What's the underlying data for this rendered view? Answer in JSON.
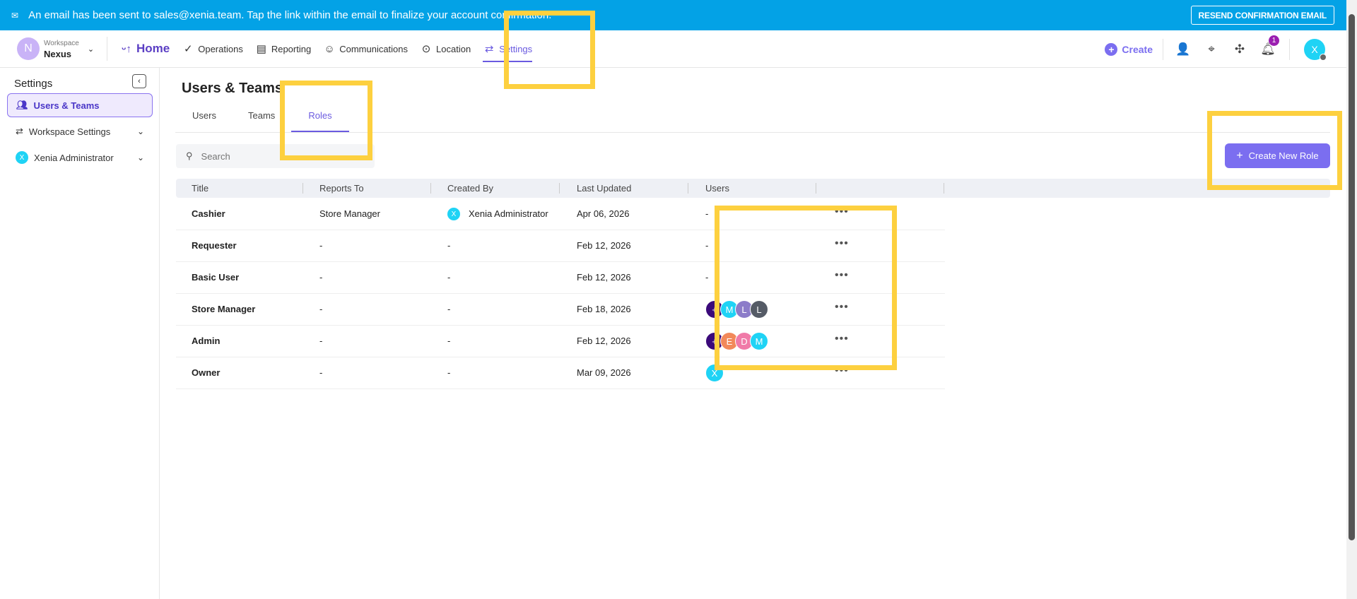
{
  "banner": {
    "message": "An email has been sent to sales@xenia.team. Tap the link within the email to finalize your account confirmation.",
    "resend": "RESEND CONFIRMATION EMAIL"
  },
  "nav": {
    "workspace_label": "Workspace",
    "workspace_name": "Nexus",
    "workspace_initial": "N",
    "home": "Home",
    "items": [
      "Operations",
      "Reporting",
      "Communications",
      "Location",
      "Settings"
    ],
    "create": "Create",
    "notification_count": "1",
    "user_initial": "X"
  },
  "sidebar": {
    "header": "Settings",
    "items": [
      {
        "label": "Users & Teams"
      },
      {
        "label": "Workspace Settings"
      },
      {
        "label": "Xenia Administrator",
        "initial": "X"
      }
    ]
  },
  "page": {
    "title": "Users & Teams",
    "tabs": [
      "Users",
      "Teams",
      "Roles"
    ],
    "search_placeholder": "Search",
    "create_role": "Create New Role"
  },
  "table": {
    "headers": [
      "Title",
      "Reports To",
      "Created By",
      "Last Updated",
      "Users"
    ],
    "rows": [
      {
        "title": "Cashier",
        "reports_to": "Store Manager",
        "created_by": "Xenia Administrator",
        "created_initial": "X",
        "updated": "Apr 06, 2026",
        "users": "-"
      },
      {
        "title": "Requester",
        "reports_to": "-",
        "created_by": "-",
        "updated": "Feb 12, 2026",
        "users": "-"
      },
      {
        "title": "Basic User",
        "reports_to": "-",
        "created_by": "-",
        "updated": "Feb 12, 2026",
        "users": "-"
      },
      {
        "title": "Store Manager",
        "reports_to": "-",
        "created_by": "-",
        "updated": "Feb 18, 2026",
        "avatars": [
          "+",
          "M",
          "L",
          "L"
        ]
      },
      {
        "title": "Admin",
        "reports_to": "-",
        "created_by": "-",
        "updated": "Feb 12, 2026",
        "avatars": [
          "+",
          "E",
          "D",
          "M"
        ]
      },
      {
        "title": "Owner",
        "reports_to": "-",
        "created_by": "-",
        "updated": "Mar 09, 2026",
        "avatars": [
          "X"
        ]
      }
    ],
    "more": "•••"
  },
  "colors": {
    "accent": "#7b6ef0",
    "banner": "#03a2e6",
    "highlight": "#fdd03f"
  }
}
